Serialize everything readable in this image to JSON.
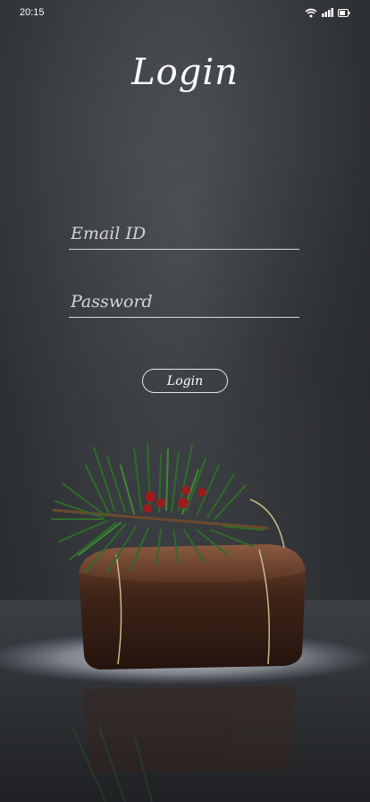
{
  "status_bar": {
    "time": "20:15",
    "icons": [
      "wifi-icon",
      "signal-icon",
      "battery-icon"
    ]
  },
  "login": {
    "title": "Login",
    "email_placeholder": "Email ID",
    "email_value": "",
    "password_placeholder": "Password",
    "password_value": "",
    "button_label": "Login"
  },
  "colors": {
    "background": "#3a3d41",
    "text": "#ffffff",
    "underline": "#d8d8d8",
    "berry": "#9b1c1c",
    "pine": "#2f6b2a",
    "cake": "#4a2a1c"
  }
}
